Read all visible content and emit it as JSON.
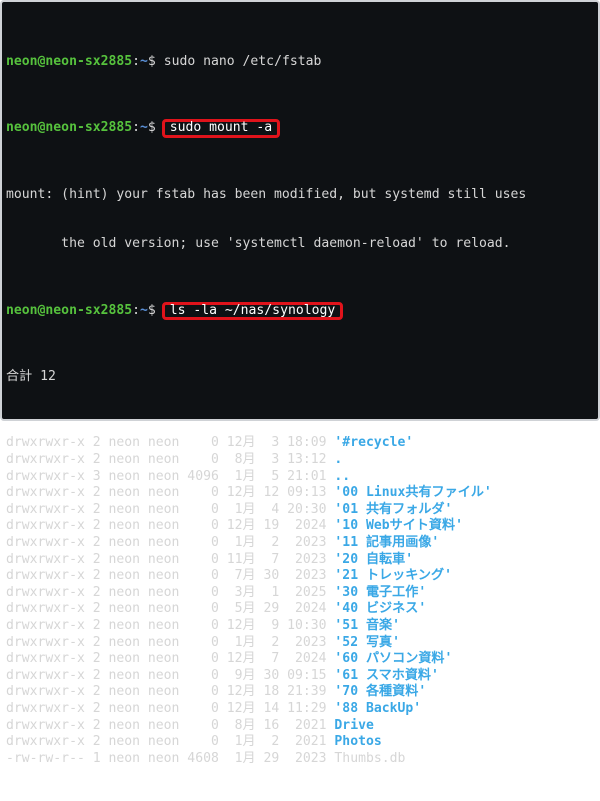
{
  "terminal": {
    "user_host": "neon@neon-sx2885",
    "path": "~",
    "prompt_symbol": "$",
    "commands": [
      {
        "text": "sudo nano /etc/fstab",
        "highlighted": false
      },
      {
        "text": "sudo mount -a",
        "highlighted": true
      },
      {
        "text": "ls -la ~/nas/synology",
        "highlighted": true
      }
    ],
    "mount_message": [
      "mount: (hint) your fstab has been modified, but systemd still uses",
      "       the old version; use 'systemctl daemon-reload' to reload."
    ],
    "total_line": "合計 12",
    "listing": [
      {
        "meta": "drwxrwxr-x 2 neon neon    0 12月  3 18:09 ",
        "name": "'#recycle'",
        "dir": true
      },
      {
        "meta": "drwxrwxr-x 2 neon neon    0  8月  3 13:12 ",
        "name": ".",
        "dir": true
      },
      {
        "meta": "drwxrwxr-x 3 neon neon 4096  1月  5 21:01 ",
        "name": "..",
        "dir": true
      },
      {
        "meta": "drwxrwxr-x 2 neon neon    0 12月 12 09:13 ",
        "name": "'00 Linux共有ファイル'",
        "dir": true
      },
      {
        "meta": "drwxrwxr-x 2 neon neon    0  1月  4 20:30 ",
        "name": "'01 共有フォルダ'",
        "dir": true
      },
      {
        "meta": "drwxrwxr-x 2 neon neon    0 12月 19  2024 ",
        "name": "'10 Webサイト資料'",
        "dir": true
      },
      {
        "meta": "drwxrwxr-x 2 neon neon    0  1月  2  2023 ",
        "name": "'11 記事用画像'",
        "dir": true
      },
      {
        "meta": "drwxrwxr-x 2 neon neon    0 11月  7  2023 ",
        "name": "'20 自転車'",
        "dir": true
      },
      {
        "meta": "drwxrwxr-x 2 neon neon    0  7月 30  2023 ",
        "name": "'21 トレッキング'",
        "dir": true
      },
      {
        "meta": "drwxrwxr-x 2 neon neon    0  3月  1  2025 ",
        "name": "'30 電子工作'",
        "dir": true
      },
      {
        "meta": "drwxrwxr-x 2 neon neon    0  5月 29  2024 ",
        "name": "'40 ビジネス'",
        "dir": true
      },
      {
        "meta": "drwxrwxr-x 2 neon neon    0 12月  9 10:30 ",
        "name": "'51 音楽'",
        "dir": true
      },
      {
        "meta": "drwxrwxr-x 2 neon neon    0  1月  2  2023 ",
        "name": "'52 写真'",
        "dir": true
      },
      {
        "meta": "drwxrwxr-x 2 neon neon    0 12月  7  2024 ",
        "name": "'60 パソコン資料'",
        "dir": true
      },
      {
        "meta": "drwxrwxr-x 2 neon neon    0  9月 30 09:15 ",
        "name": "'61 スマホ資料'",
        "dir": true
      },
      {
        "meta": "drwxrwxr-x 2 neon neon    0 12月 18 21:39 ",
        "name": "'70 各種資料'",
        "dir": true
      },
      {
        "meta": "drwxrwxr-x 2 neon neon    0 12月 14 11:29 ",
        "name": "'88 BackUp'",
        "dir": true
      },
      {
        "meta": "drwxrwxr-x 2 neon neon    0  8月 16  2021 ",
        "name": "Drive",
        "dir": true
      },
      {
        "meta": "drwxrwxr-x 2 neon neon    0  1月  2  2021 ",
        "name": "Photos",
        "dir": true
      },
      {
        "meta": "-rw-rw-r-- 1 neon neon 4608  1月 29  2023 ",
        "name": "Thumbs.db",
        "dir": false
      }
    ]
  },
  "colors": {
    "background": "#0e1114",
    "prompt_user": "#56c23d",
    "prompt_path": "#5a8fd6",
    "text": "#d6d6d6",
    "directory": "#3aa8e6",
    "highlight_box": "#e0131b"
  }
}
